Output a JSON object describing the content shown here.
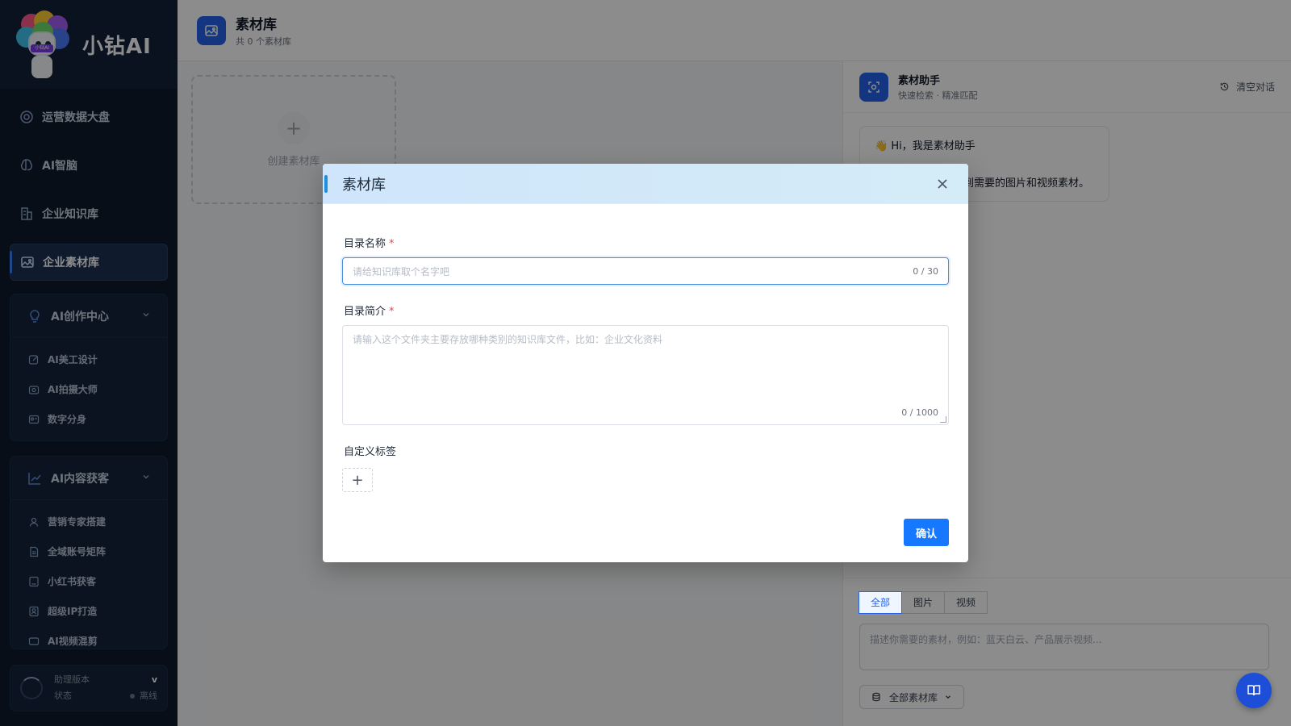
{
  "sidebar": {
    "brand": "小钻AI",
    "logo_tag": "小钻AI",
    "nav": [
      {
        "label": "运营数据大盘",
        "icon": "dashboard-icon"
      },
      {
        "label": "AI智脑",
        "icon": "brain-icon"
      },
      {
        "label": "企业知识库",
        "icon": "building-icon"
      },
      {
        "label": "企业素材库",
        "icon": "image-icon",
        "active": true
      }
    ],
    "groups": [
      {
        "label": "AI创作中心",
        "icon": "bulb-icon",
        "items": [
          "AI美工设计",
          "AI拍摄大师",
          "数字分身"
        ]
      },
      {
        "label": "AI内容获客",
        "icon": "trend-icon",
        "items": [
          "营销专家搭建",
          "全域账号矩阵",
          "小红书获客",
          "超级IP打造",
          "AI视频混剪"
        ]
      }
    ],
    "version": {
      "label": "助理版本",
      "status_label": "状态",
      "value": "v",
      "status": "离线"
    }
  },
  "topbar": {
    "title": "素材库",
    "subtitle": "共 0 个素材库"
  },
  "create_card": {
    "label": "创建素材库"
  },
  "assistant": {
    "title": "素材助手",
    "subtitle": "快速检索 · 精准匹配",
    "clear_label": "清空对话",
    "greeting": "👋 Hi，我是素材助手",
    "greeting_line2": "到需要的图片和视频素材。",
    "tabs": [
      "全部",
      "图片",
      "视频"
    ],
    "input_placeholder": "描述你需要的素材，例如：蓝天白云、产品展示视频...",
    "library_select": "全部素材库"
  },
  "modal": {
    "title": "素材库",
    "name_label": "目录名称",
    "name_placeholder": "请给知识库取个名字吧",
    "name_counter": "0 / 30",
    "desc_label": "目录简介",
    "desc_placeholder": "请输入这个文件夹主要存放哪种类别的知识库文件，比如：企业文化资料",
    "desc_counter": "0 / 1000",
    "tags_label": "自定义标签",
    "add_tag": "+",
    "confirm": "确认",
    "required_mark": "*"
  }
}
